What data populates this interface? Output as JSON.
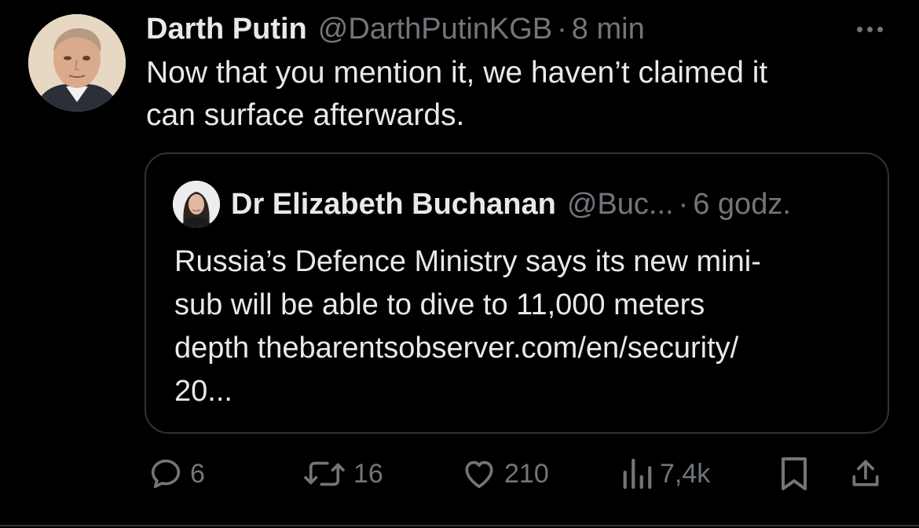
{
  "tweet": {
    "author_name": "Darth Putin",
    "author_handle": "@DarthPutinKGB",
    "separator": "·",
    "timestamp": "8 min",
    "text_line1": "Now that you mention it, we haven’t claimed it",
    "text_line2": "can surface afterwards."
  },
  "quote": {
    "author_name": "Dr Elizabeth Buchanan",
    "author_handle": "@Buc...",
    "separator": "·",
    "timestamp": "6 godz.",
    "text_line1": "Russia’s Defence Ministry says its new mini-",
    "text_line2": "sub will be able to dive to 11,000 meters",
    "text_line3": "depth  thebarentsobserver.com/en/security/",
    "text_line4": "20..."
  },
  "actions": {
    "replies": "6",
    "reposts": "16",
    "likes": "210",
    "views": "7,4k"
  },
  "icons": {
    "more": "more-horizontal-icon",
    "reply": "reply-icon",
    "repost": "repost-icon",
    "like": "heart-icon",
    "views": "views-chart-icon",
    "bookmark": "bookmark-icon",
    "share": "share-icon"
  },
  "colors": {
    "background": "#000000",
    "text_primary": "#e7e9ea",
    "text_secondary": "#71767b",
    "border": "#2f3336"
  }
}
